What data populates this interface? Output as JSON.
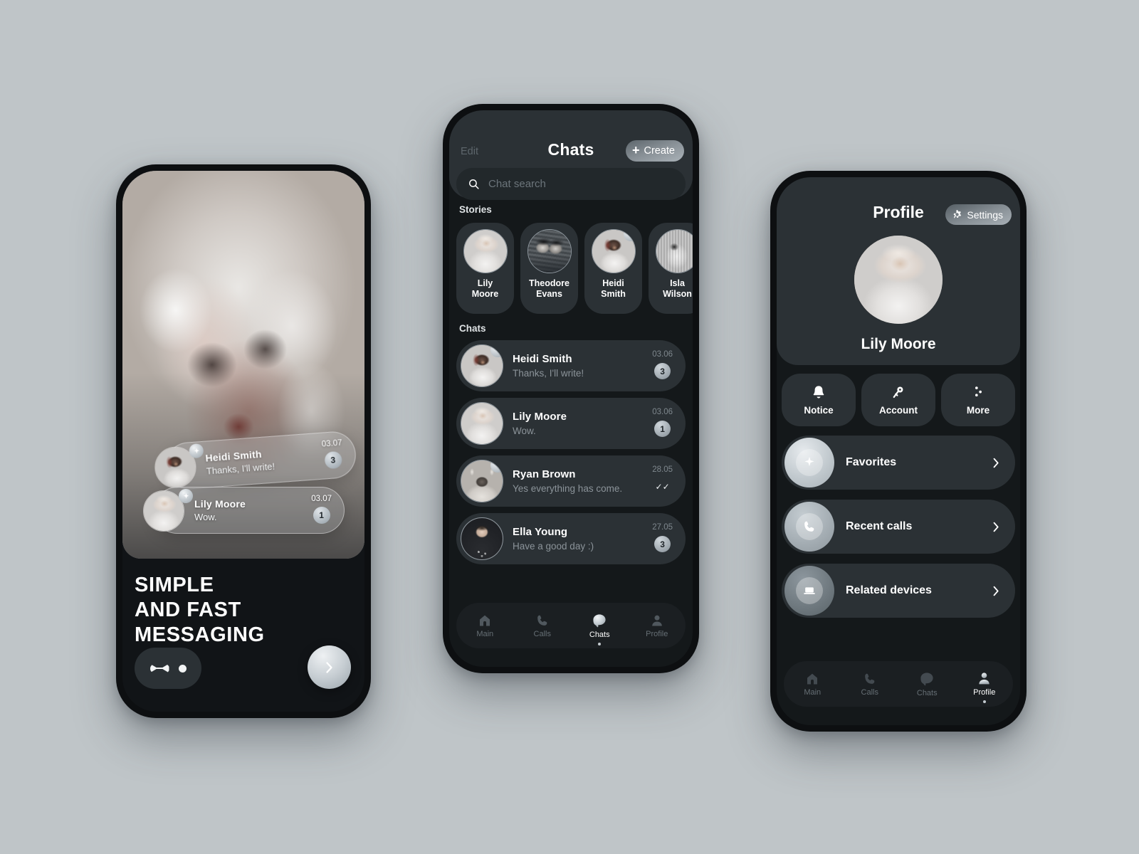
{
  "meta": {
    "background_color": "#bfc5c8",
    "surface_color": "#2b3135",
    "screen_color": "#14181a",
    "accent_text": "#ffffff"
  },
  "phone_onboarding": {
    "headline": "SIMPLE\nAND FAST\nMESSAGING",
    "headline_lines": [
      "SIMPLE",
      "AND FAST",
      "MESSAGING"
    ],
    "next_icon": "chevron-right-icon",
    "pager": {
      "total": 2,
      "active_index": 0
    },
    "cards": [
      {
        "name": "Heidi Smith",
        "message": "Thanks, I'll write!",
        "time": "03.07",
        "badge": "3",
        "has_story_badge": true,
        "avatar": "heidi-avatar"
      },
      {
        "name": "Lily Moore",
        "message": "Wow.",
        "time": "03.07",
        "badge": "1",
        "has_story_badge": true,
        "avatar": "lily-avatar"
      }
    ]
  },
  "phone_chats": {
    "header": {
      "edit_label": "Edit",
      "title": "Chats",
      "create_label": "Create",
      "create_icon": "plus-icon"
    },
    "search": {
      "placeholder": "Chat search",
      "icon": "search-icon",
      "value": ""
    },
    "sections": {
      "stories_label": "Stories",
      "chats_label": "Chats"
    },
    "stories": [
      {
        "name": "Lily\nMoore",
        "line1": "Lily",
        "line2": "Moore",
        "avatar": "lily-avatar",
        "has_new": false
      },
      {
        "name": "Theodore\nEvans",
        "line1": "Theodore",
        "line2": "Evans",
        "avatar": "theodore-avatar",
        "has_new": false
      },
      {
        "name": "Heidi\nSmith",
        "line1": "Heidi",
        "line2": "Smith",
        "avatar": "heidi-avatar",
        "has_new": true
      },
      {
        "name": "Isla\nWilson",
        "line1": "Isla",
        "line2": "Wilson",
        "avatar": "isla-avatar",
        "has_new": false
      }
    ],
    "chats": [
      {
        "name": "Heidi Smith",
        "message": "Thanks, I'll write!",
        "time": "03.06",
        "badge": "3",
        "status": "",
        "has_story_badge": true,
        "avatar": "heidi-avatar"
      },
      {
        "name": "Lily Moore",
        "message": "Wow.",
        "time": "03.06",
        "badge": "1",
        "status": "",
        "has_story_badge": false,
        "avatar": "lily-avatar"
      },
      {
        "name": "Ryan Brown",
        "message": "Yes everything has come.",
        "time": "28.05",
        "badge": "",
        "status": "read-double-check",
        "status_glyph": "✓✓",
        "has_story_badge": true,
        "avatar": "ryan-avatar"
      },
      {
        "name": "Ella Young",
        "message": "Have a good day :)",
        "time": "27.05",
        "badge": "3",
        "status": "",
        "has_story_badge": false,
        "avatar": "ella-avatar"
      }
    ],
    "tabs": [
      {
        "label": "Main",
        "icon": "home-icon",
        "active": false
      },
      {
        "label": "Calls",
        "icon": "phone-icon",
        "active": false
      },
      {
        "label": "Chats",
        "icon": "chat-bubble-icon",
        "active": true
      },
      {
        "label": "Profile",
        "icon": "person-icon",
        "active": false
      }
    ]
  },
  "phone_profile": {
    "header": {
      "title": "Profile",
      "settings_label": "Settings",
      "settings_icon": "gear-icon"
    },
    "user": {
      "name": "Lily Moore",
      "avatar": "lily-avatar"
    },
    "actions": [
      {
        "label": "Notice",
        "icon": "bell-icon"
      },
      {
        "label": "Account",
        "icon": "key-icon"
      },
      {
        "label": "More",
        "icon": "more-dots-icon"
      }
    ],
    "menu": [
      {
        "label": "Favorites",
        "icon": "sparkle-icon",
        "chevron": "chevron-right-icon"
      },
      {
        "label": "Recent calls",
        "icon": "phone-icon",
        "chevron": "chevron-right-icon"
      },
      {
        "label": "Related devices",
        "icon": "laptop-icon",
        "chevron": "chevron-right-icon"
      }
    ],
    "tabs": [
      {
        "label": "Main",
        "icon": "home-icon",
        "active": false
      },
      {
        "label": "Calls",
        "icon": "phone-icon",
        "active": false
      },
      {
        "label": "Chats",
        "icon": "chat-bubble-icon",
        "active": false
      },
      {
        "label": "Profile",
        "icon": "person-icon",
        "active": true
      }
    ]
  }
}
